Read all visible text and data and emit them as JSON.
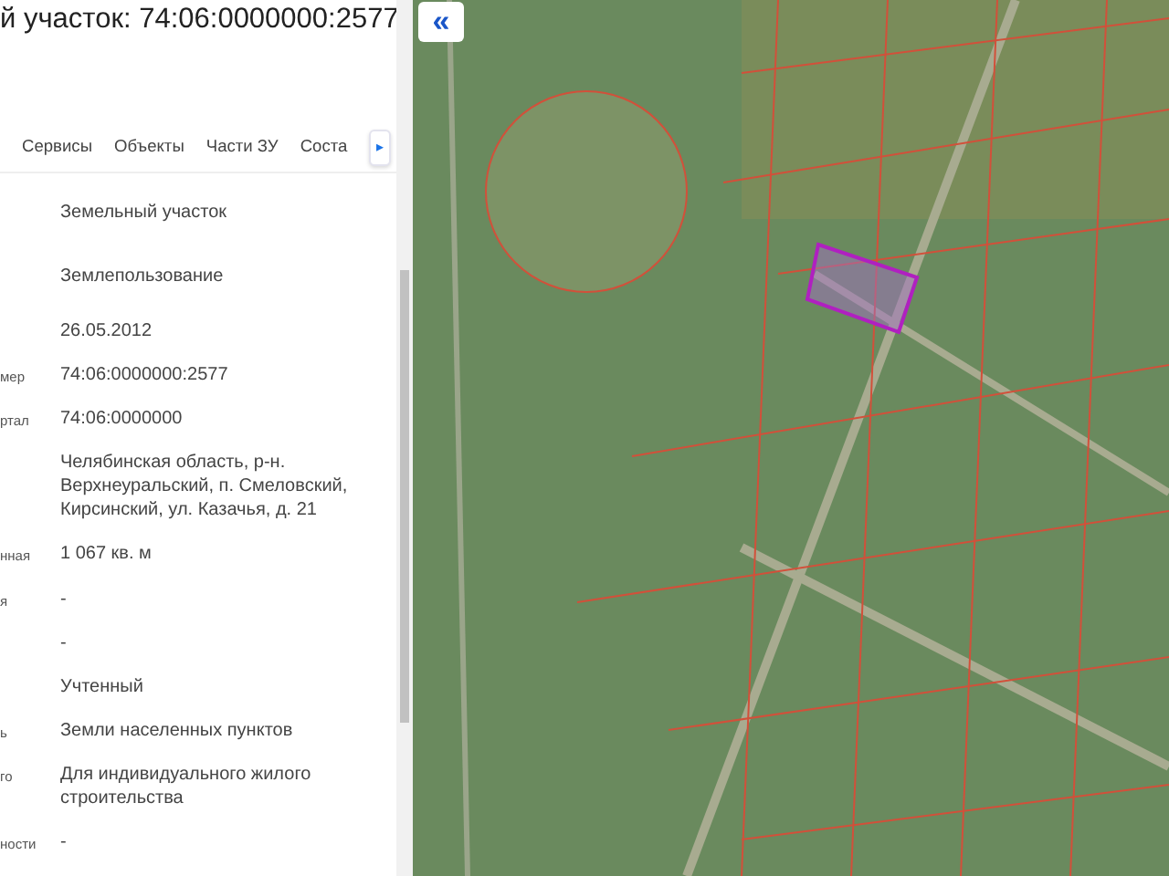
{
  "title": "й участок: 74:06:0000000:2577",
  "tabs": [
    {
      "label": "Сервисы",
      "selected": false
    },
    {
      "label": "Объекты",
      "selected": false
    },
    {
      "label": "Части ЗУ",
      "selected": false
    },
    {
      "label": "Соста",
      "selected": false
    }
  ],
  "tabs_scroll": {
    "label": "▸"
  },
  "rows": [
    {
      "value": "Земельный участок"
    },
    {
      "value": "Землепользование"
    },
    {
      "value": "26.05.2012"
    },
    {
      "label": "мер",
      "value": "74:06:0000000:2577"
    },
    {
      "label": "ртал",
      "value": "74:06:0000000"
    },
    {
      "value": "Челябинская область, р-н. Верхнеуральский, п. Смеловский, Кирсинский, ул. Казачья, д. 21"
    },
    {
      "label": "нная",
      "value": "1 067 кв. м"
    },
    {
      "label": "я",
      "value": "-"
    },
    {
      "value": "-"
    },
    {
      "value": "Учтенный"
    },
    {
      "label": "ь",
      "value": "Земли населенных пунктов"
    },
    {
      "label": "го",
      "value": "Для индивидуального жилого строительства"
    },
    {
      "label": "ности",
      "value": "-"
    }
  ],
  "map": {
    "collapse_button": "«"
  }
}
